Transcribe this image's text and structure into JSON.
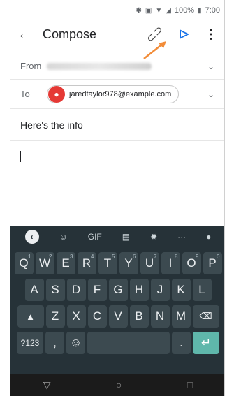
{
  "status": {
    "battery": "100%",
    "time": "7:00"
  },
  "appbar": {
    "title": "Compose"
  },
  "from": {
    "label": "From"
  },
  "to": {
    "label": "To",
    "recipient": "jaredtaylor978@example.com"
  },
  "subject": "Here's the info",
  "toolbar": {
    "gif": "GIF"
  },
  "keyboard": {
    "row1": [
      {
        "k": "Q",
        "n": "1"
      },
      {
        "k": "W",
        "n": "2"
      },
      {
        "k": "E",
        "n": "3"
      },
      {
        "k": "R",
        "n": "4"
      },
      {
        "k": "T",
        "n": "5"
      },
      {
        "k": "Y",
        "n": "6"
      },
      {
        "k": "U",
        "n": "7"
      },
      {
        "k": "I",
        "n": "8"
      },
      {
        "k": "O",
        "n": "9"
      },
      {
        "k": "P",
        "n": "0"
      }
    ],
    "row2": [
      "A",
      "S",
      "D",
      "F",
      "G",
      "H",
      "J",
      "K",
      "L"
    ],
    "row3": [
      "Z",
      "X",
      "C",
      "V",
      "B",
      "N",
      "M"
    ],
    "symbols": "?123",
    "comma": ",",
    "period": "."
  }
}
